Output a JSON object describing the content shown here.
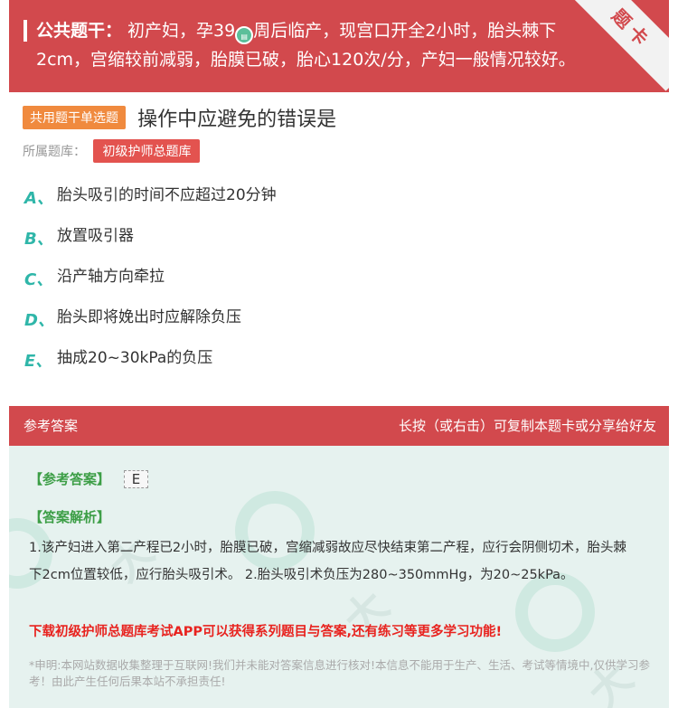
{
  "stem": {
    "label": "公共题干：",
    "text_before_logo": "初产妇，孕39",
    "text_after_logo": "周后临产，现宫口开全2小时，胎头棘下2cm，宫缩较前减弱，胎膜已破，胎心120次/分，产妇一般情况较好。",
    "corner_label": "题卡"
  },
  "question": {
    "type_tag": "共用题干单选题",
    "text": "操作中应避免的错误是",
    "bank_label": "所属题库：",
    "bank_name": "初级护师总题库"
  },
  "options": [
    {
      "letter": "A、",
      "text": "胎头吸引的时间不应超过20分钟"
    },
    {
      "letter": "B、",
      "text": "放置吸引器"
    },
    {
      "letter": "C、",
      "text": "沿产轴方向牵拉"
    },
    {
      "letter": "D、",
      "text": "胎头即将娩出时应解除负压"
    },
    {
      "letter": "E、",
      "text": "抽成20~30kPa的负压"
    }
  ],
  "answer": {
    "header_left": "参考答案",
    "header_right": "长按（或右击）可复制本题卡或分享给好友",
    "ref_label": "【参考答案】",
    "ref_value": "E",
    "analysis_label": "【答案解析】",
    "analysis_text": "1.该产妇进入第二产程已2小时，胎膜已破，宫缩减弱故应尽快结束第二产程，应行会阴侧切术，胎头棘下2cm位置较低，应行胎头吸引术。 2.胎头吸引术负压为280~350mmHg，为20~25kPa。",
    "promo": "下载初级护师总题库考试APP可以获得系列题目与答案,还有练习等更多学习功能!",
    "disclaimer": "*申明:本网站数据收集整理于互联网!我们并未能对答案信息进行核对!本信息不能用于生产、生活、考试等情境中,仅供学习参考！由此产生任何后果本站不承担责任!"
  },
  "colors": {
    "header_red": "#d2494d",
    "option_letter": "#2fb6a9",
    "tag_orange": "#f08a3e",
    "tag_red": "#e3534f",
    "answer_green": "#3c9e46",
    "promo_red": "#e8231f"
  }
}
